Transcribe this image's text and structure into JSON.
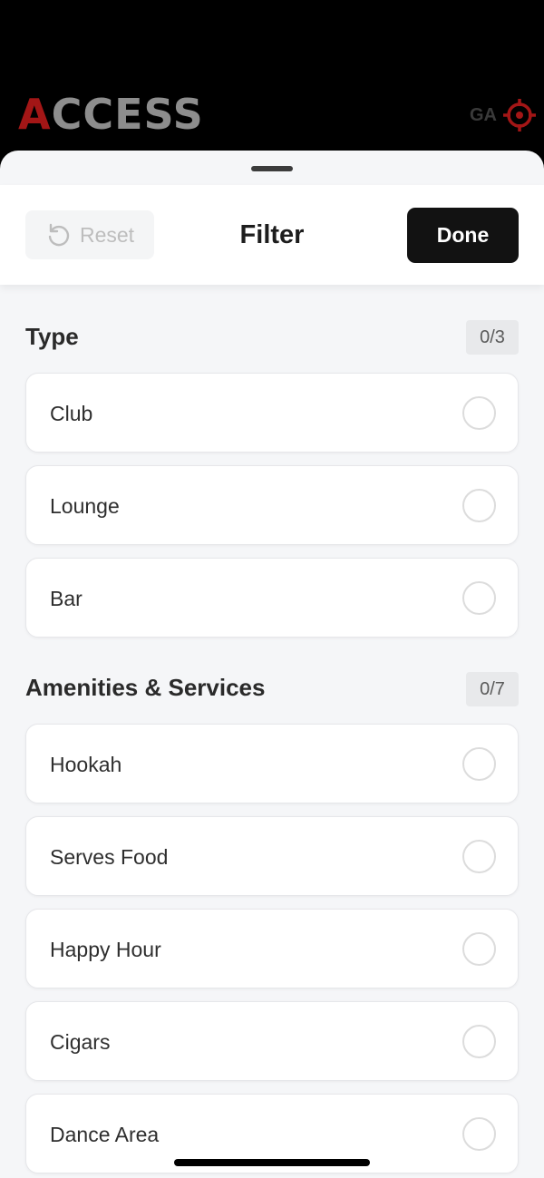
{
  "background_app": {
    "logo_first_letter": "A",
    "logo_rest": "CCESS",
    "right_text": "GA",
    "icons": [
      "target-icon"
    ]
  },
  "sheet": {
    "header": {
      "reset_label": "Reset",
      "title": "Filter",
      "done_label": "Done"
    },
    "sections": [
      {
        "title": "Type",
        "count": "0/3",
        "options": [
          "Club",
          "Lounge",
          "Bar"
        ]
      },
      {
        "title": "Amenities & Services",
        "count": "0/7",
        "options": [
          "Hookah",
          "Serves Food",
          "Happy Hour",
          "Cigars",
          "Dance Area"
        ]
      }
    ]
  },
  "colors": {
    "logo_red": "#a31616",
    "done_bg": "#121212",
    "sheet_bg": "#f5f6f8"
  }
}
